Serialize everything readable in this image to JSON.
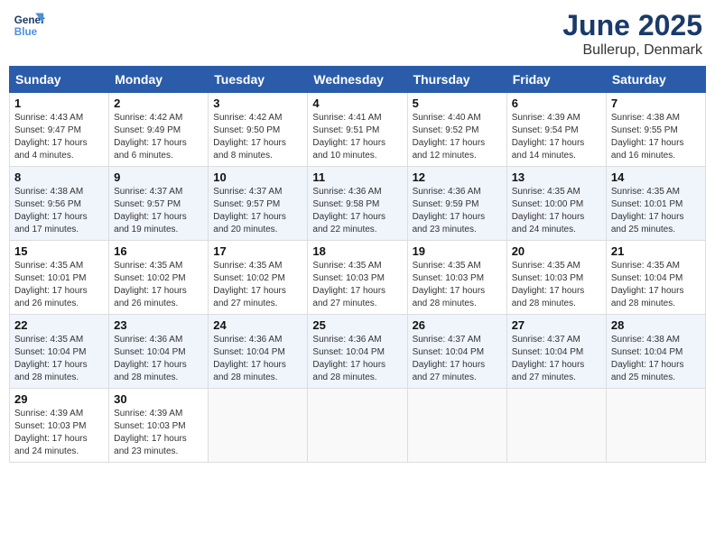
{
  "logo": {
    "line1": "General",
    "line2": "Blue"
  },
  "title": "June 2025",
  "subtitle": "Bullerup, Denmark",
  "headers": [
    "Sunday",
    "Monday",
    "Tuesday",
    "Wednesday",
    "Thursday",
    "Friday",
    "Saturday"
  ],
  "weeks": [
    [
      {
        "day": "1",
        "info": "Sunrise: 4:43 AM\nSunset: 9:47 PM\nDaylight: 17 hours\nand 4 minutes."
      },
      {
        "day": "2",
        "info": "Sunrise: 4:42 AM\nSunset: 9:49 PM\nDaylight: 17 hours\nand 6 minutes."
      },
      {
        "day": "3",
        "info": "Sunrise: 4:42 AM\nSunset: 9:50 PM\nDaylight: 17 hours\nand 8 minutes."
      },
      {
        "day": "4",
        "info": "Sunrise: 4:41 AM\nSunset: 9:51 PM\nDaylight: 17 hours\nand 10 minutes."
      },
      {
        "day": "5",
        "info": "Sunrise: 4:40 AM\nSunset: 9:52 PM\nDaylight: 17 hours\nand 12 minutes."
      },
      {
        "day": "6",
        "info": "Sunrise: 4:39 AM\nSunset: 9:54 PM\nDaylight: 17 hours\nand 14 minutes."
      },
      {
        "day": "7",
        "info": "Sunrise: 4:38 AM\nSunset: 9:55 PM\nDaylight: 17 hours\nand 16 minutes."
      }
    ],
    [
      {
        "day": "8",
        "info": "Sunrise: 4:38 AM\nSunset: 9:56 PM\nDaylight: 17 hours\nand 17 minutes."
      },
      {
        "day": "9",
        "info": "Sunrise: 4:37 AM\nSunset: 9:57 PM\nDaylight: 17 hours\nand 19 minutes."
      },
      {
        "day": "10",
        "info": "Sunrise: 4:37 AM\nSunset: 9:57 PM\nDaylight: 17 hours\nand 20 minutes."
      },
      {
        "day": "11",
        "info": "Sunrise: 4:36 AM\nSunset: 9:58 PM\nDaylight: 17 hours\nand 22 minutes."
      },
      {
        "day": "12",
        "info": "Sunrise: 4:36 AM\nSunset: 9:59 PM\nDaylight: 17 hours\nand 23 minutes."
      },
      {
        "day": "13",
        "info": "Sunrise: 4:35 AM\nSunset: 10:00 PM\nDaylight: 17 hours\nand 24 minutes."
      },
      {
        "day": "14",
        "info": "Sunrise: 4:35 AM\nSunset: 10:01 PM\nDaylight: 17 hours\nand 25 minutes."
      }
    ],
    [
      {
        "day": "15",
        "info": "Sunrise: 4:35 AM\nSunset: 10:01 PM\nDaylight: 17 hours\nand 26 minutes."
      },
      {
        "day": "16",
        "info": "Sunrise: 4:35 AM\nSunset: 10:02 PM\nDaylight: 17 hours\nand 26 minutes."
      },
      {
        "day": "17",
        "info": "Sunrise: 4:35 AM\nSunset: 10:02 PM\nDaylight: 17 hours\nand 27 minutes."
      },
      {
        "day": "18",
        "info": "Sunrise: 4:35 AM\nSunset: 10:03 PM\nDaylight: 17 hours\nand 27 minutes."
      },
      {
        "day": "19",
        "info": "Sunrise: 4:35 AM\nSunset: 10:03 PM\nDaylight: 17 hours\nand 28 minutes."
      },
      {
        "day": "20",
        "info": "Sunrise: 4:35 AM\nSunset: 10:03 PM\nDaylight: 17 hours\nand 28 minutes."
      },
      {
        "day": "21",
        "info": "Sunrise: 4:35 AM\nSunset: 10:04 PM\nDaylight: 17 hours\nand 28 minutes."
      }
    ],
    [
      {
        "day": "22",
        "info": "Sunrise: 4:35 AM\nSunset: 10:04 PM\nDaylight: 17 hours\nand 28 minutes."
      },
      {
        "day": "23",
        "info": "Sunrise: 4:36 AM\nSunset: 10:04 PM\nDaylight: 17 hours\nand 28 minutes."
      },
      {
        "day": "24",
        "info": "Sunrise: 4:36 AM\nSunset: 10:04 PM\nDaylight: 17 hours\nand 28 minutes."
      },
      {
        "day": "25",
        "info": "Sunrise: 4:36 AM\nSunset: 10:04 PM\nDaylight: 17 hours\nand 28 minutes."
      },
      {
        "day": "26",
        "info": "Sunrise: 4:37 AM\nSunset: 10:04 PM\nDaylight: 17 hours\nand 27 minutes."
      },
      {
        "day": "27",
        "info": "Sunrise: 4:37 AM\nSunset: 10:04 PM\nDaylight: 17 hours\nand 27 minutes."
      },
      {
        "day": "28",
        "info": "Sunrise: 4:38 AM\nSunset: 10:04 PM\nDaylight: 17 hours\nand 25 minutes."
      }
    ],
    [
      {
        "day": "29",
        "info": "Sunrise: 4:39 AM\nSunset: 10:03 PM\nDaylight: 17 hours\nand 24 minutes."
      },
      {
        "day": "30",
        "info": "Sunrise: 4:39 AM\nSunset: 10:03 PM\nDaylight: 17 hours\nand 23 minutes."
      },
      {
        "day": "",
        "info": ""
      },
      {
        "day": "",
        "info": ""
      },
      {
        "day": "",
        "info": ""
      },
      {
        "day": "",
        "info": ""
      },
      {
        "day": "",
        "info": ""
      }
    ]
  ]
}
